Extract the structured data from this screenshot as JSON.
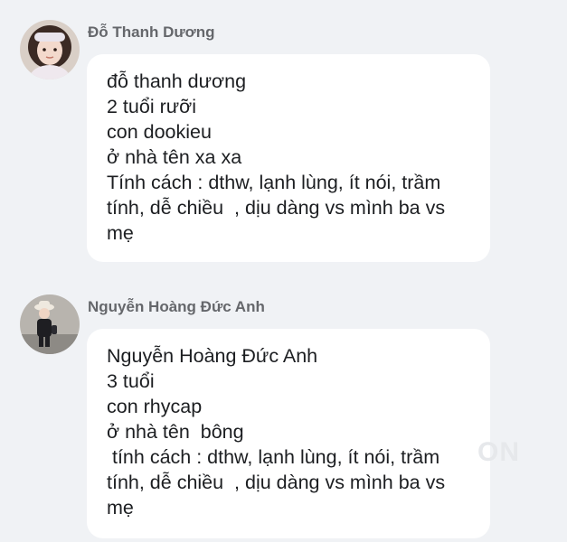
{
  "posts": [
    {
      "author": "Đỗ Thanh Dương",
      "avatar_icon": "child-portrait-avatar",
      "lines": [
        "đỗ thanh dương",
        "2 tuổi rưỡi",
        "con dookieu",
        "ở nhà tên xa xa",
        "Tính cách : dthw, lạnh lùng, ít nói, trầm tính, dễ chiều  , dịu dàng vs mình ba vs mẹ"
      ]
    },
    {
      "author": "Nguyễn Hoàng Đức Anh",
      "avatar_icon": "boy-in-hat-avatar",
      "lines": [
        "Nguyễn Hoàng Đức Anh",
        "3 tuổi",
        "con rhycap",
        "ở nhà tên  bông",
        " tính cách : dthw, lạnh lùng, ít nói, trầm tính, dễ chiều  , dịu dàng vs mình ba vs mẹ"
      ]
    }
  ],
  "watermark": "ON",
  "colors": {
    "background": "#f0f2f5",
    "bubble": "#ffffff",
    "author": "#65676b",
    "text": "#1c1e21"
  }
}
